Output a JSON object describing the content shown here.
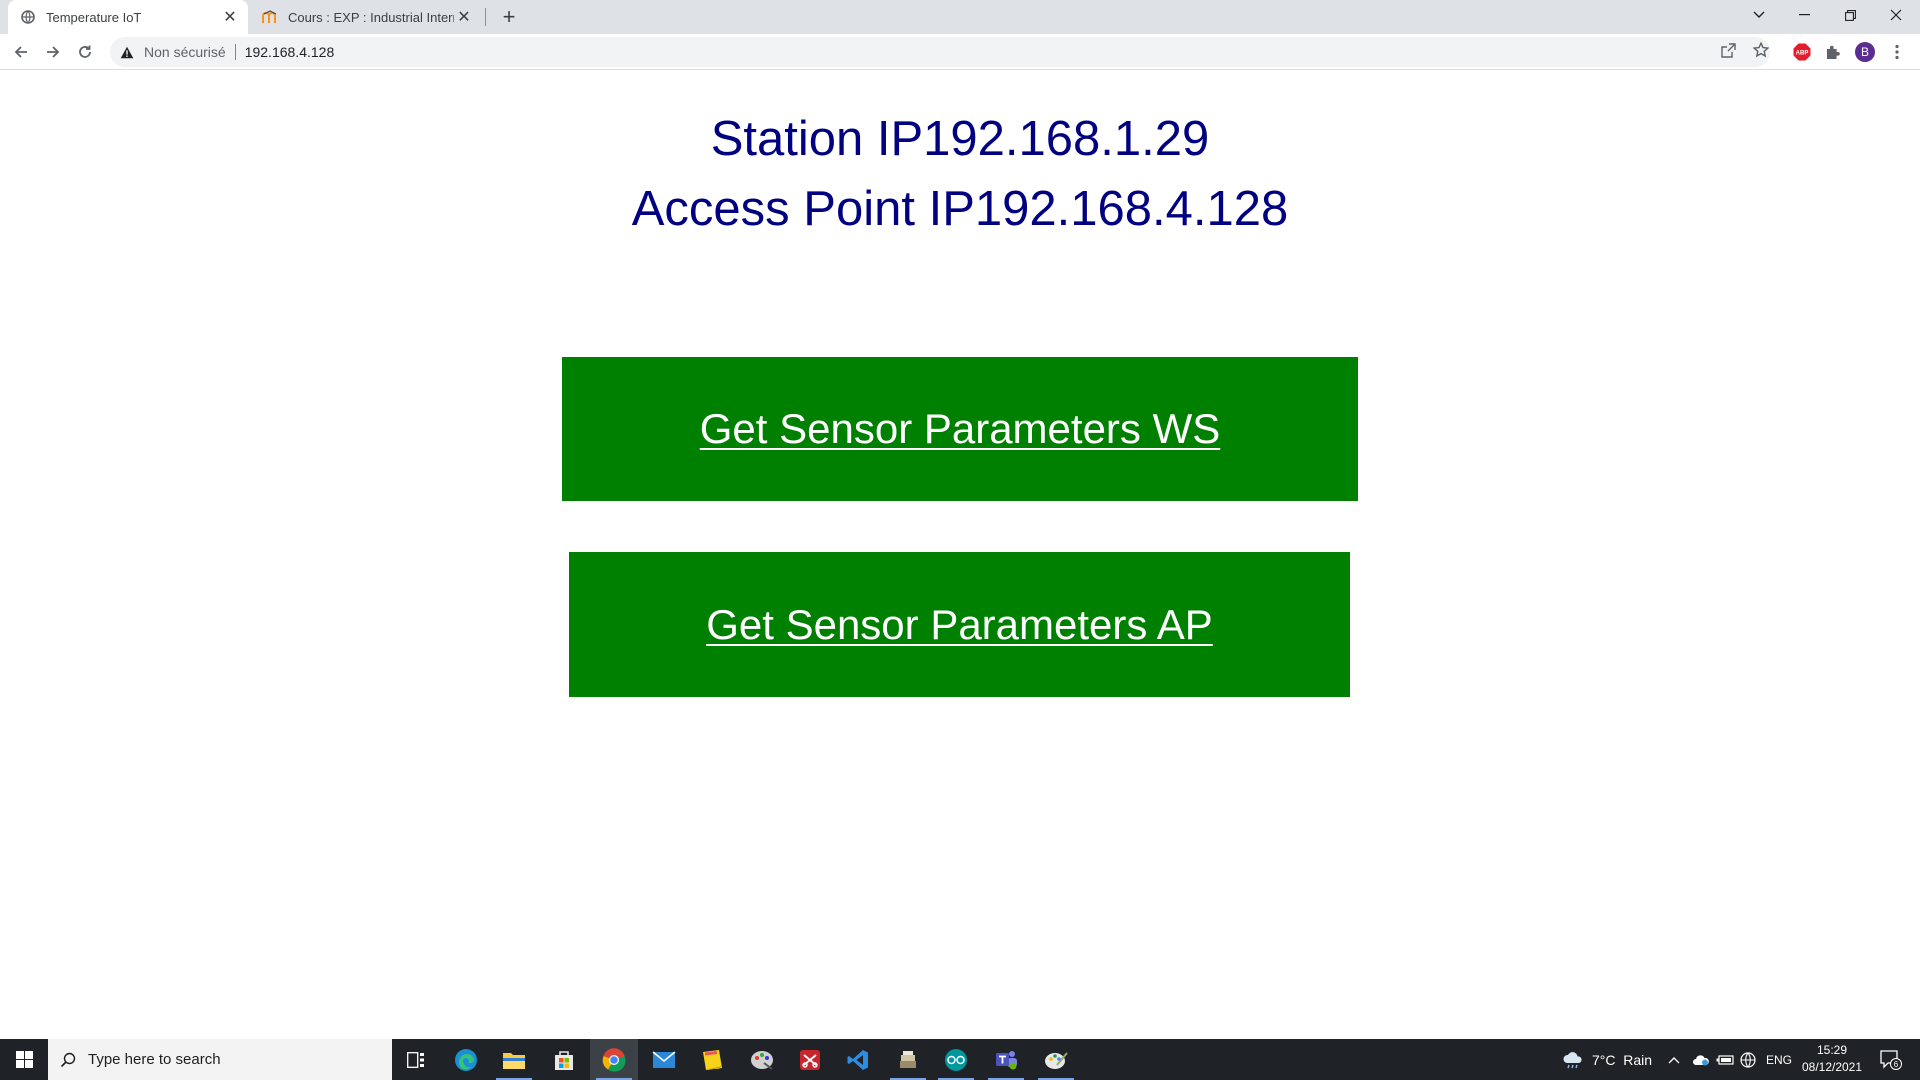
{
  "browser": {
    "tabs": [
      {
        "title": "Temperature IoT",
        "active": true
      },
      {
        "title": "Cours : EXP : Industrial Internet o",
        "active": false
      }
    ],
    "address": {
      "security_label": "Non sécurisé",
      "url": "192.168.4.128"
    },
    "profile_initial": "B",
    "abp_label": "ABP"
  },
  "page": {
    "station_ip_line": "Station IP192.168.1.29",
    "access_point_ip_line": "Access Point IP192.168.4.128",
    "button_ws_label": "Get Sensor Parameters WS",
    "button_ap_label": "Get Sensor Parameters AP",
    "button_color": "#008000",
    "heading_color": "#000080"
  },
  "taskbar": {
    "search_placeholder": "Type here to search",
    "weather": "7°C  Rain",
    "language": "ENG",
    "time": "15:29",
    "date": "08/12/2021",
    "notification_count": "6"
  }
}
